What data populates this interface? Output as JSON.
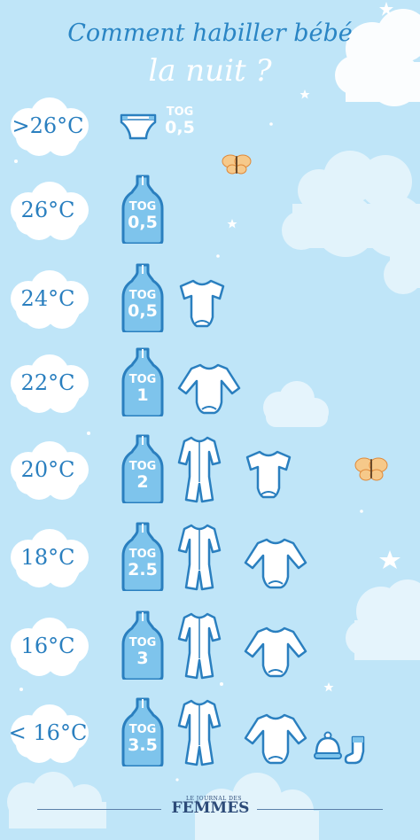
{
  "title": {
    "line1": "Comment habiller bébé",
    "line2": "la nuit ?"
  },
  "tog_label": "TOG",
  "rows": [
    {
      "temp": ">26°C",
      "tog": "0,5",
      "items": [
        "diaper-icon"
      ]
    },
    {
      "temp": "26°C",
      "tog": "0,5",
      "items": [
        "sleeping-bag-icon"
      ]
    },
    {
      "temp": "24°C",
      "tog": "0,5",
      "items": [
        "sleeping-bag-icon",
        "short-sleeve-bodysuit-icon"
      ]
    },
    {
      "temp": "22°C",
      "tog": "1",
      "items": [
        "sleeping-bag-icon",
        "long-sleeve-bodysuit-icon"
      ]
    },
    {
      "temp": "20°C",
      "tog": "2",
      "items": [
        "sleeping-bag-icon",
        "pajama-icon",
        "short-sleeve-bodysuit-icon"
      ]
    },
    {
      "temp": "18°C",
      "tog": "2.5",
      "items": [
        "sleeping-bag-icon",
        "pajama-icon",
        "long-sleeve-bodysuit-icon"
      ]
    },
    {
      "temp": "16°C",
      "tog": "3",
      "items": [
        "sleeping-bag-icon",
        "pajama-icon",
        "long-sleeve-bodysuit-icon"
      ]
    },
    {
      "temp": "< 16°C",
      "tog": "3.5",
      "items": [
        "sleeping-bag-icon",
        "pajama-icon",
        "long-sleeve-bodysuit-icon",
        "hat-icon",
        "sock-icon"
      ]
    }
  ],
  "footer": {
    "logo_small": "LE JOURNAL DES",
    "logo_main": "FEMMES"
  },
  "colors": {
    "background": "#bfe5f8",
    "icon_fill": "#7ec4ec",
    "icon_stroke": "#2a7fbf",
    "title": "#2a85c4"
  }
}
